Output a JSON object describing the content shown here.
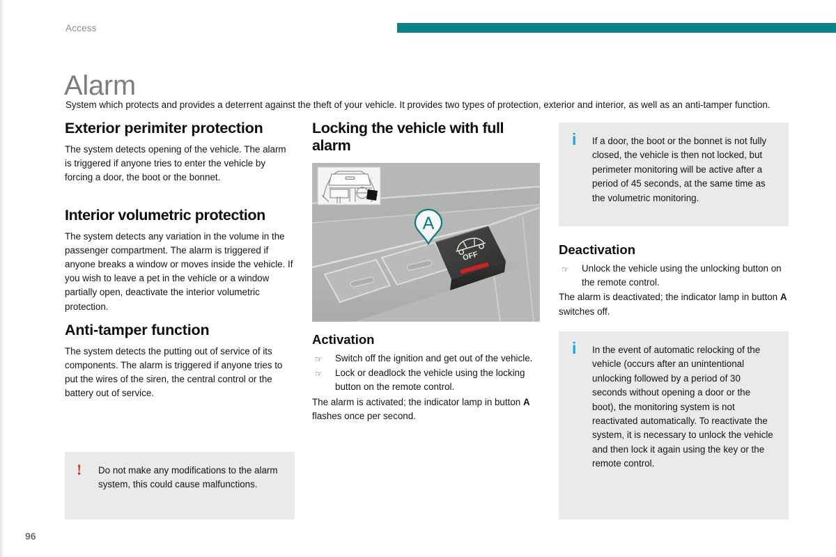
{
  "header": {
    "section_label": "Access",
    "rule_color": "#06828a"
  },
  "title": "Alarm",
  "intro": "System which protects and provides a deterrent against the theft of your vehicle. It provides two types of protection, exterior and interior, as well as an anti-tamper function.",
  "left_column": {
    "exterior": {
      "heading": "Exterior perimiter protection",
      "body": "The system detects opening of the vehicle. The alarm is triggered if anyone tries to enter the vehicle by forcing a door, the boot or the bonnet."
    },
    "interior": {
      "heading": "Interior volumetric protection",
      "body": "The system detects any variation in the volume in the passenger compartment. The alarm is triggered if anyone breaks a window or moves inside the vehicle. If you wish to leave a pet in the vehicle or a window partially open, deactivate the interior volumetric protection."
    },
    "antitamper": {
      "heading": "Anti-tamper function",
      "body": "The system detects the putting out of service of its components. The alarm is triggered if anyone tries to put the wires of the siren, the central control or the battery out of service."
    },
    "warning_callout": {
      "icon": "exclamation-icon",
      "icon_glyph": "!",
      "icon_color": "#e03030",
      "text": "Do not make any modifications to the alarm system, this could cause malfunctions."
    }
  },
  "middle_column": {
    "heading": "Locking the vehicle with full alarm",
    "figure": {
      "name": "dashboard-alarm-button-photo",
      "callout_letter": "A",
      "callout_color": "#0b7a7f",
      "button_label": "OFF",
      "inset_name": "vehicle-interior-location-diagram"
    },
    "activation": {
      "heading": "Activation",
      "steps": [
        "Switch off the ignition and get out of the vehicle.",
        "Lock or deadlock the vehicle using the locking button on the remote control."
      ],
      "result_prefix": "The alarm is activated; the indicator lamp in button ",
      "result_button": "A",
      "result_suffix": " flashes once per second."
    }
  },
  "right_column": {
    "info_callout_1": {
      "icon": "info-icon",
      "icon_glyph": "i",
      "icon_color": "#1ba0e0",
      "text": "If a door, the boot or the bonnet is not fully closed, the vehicle is then not locked, but perimeter monitoring will be active after a period of 45 seconds, at the same time as the volumetric monitoring."
    },
    "deactivation": {
      "heading": "Deactivation",
      "steps": [
        "Unlock the vehicle using the unlocking button on the remote control."
      ],
      "result_prefix": "The alarm is deactivated; the indicator lamp in button ",
      "result_button": "A",
      "result_suffix": " switches off."
    },
    "info_callout_2": {
      "icon": "info-icon",
      "icon_glyph": "i",
      "icon_color": "#1ba0e0",
      "text": "In the event of automatic relocking of the vehicle (occurs after an unintentional unlocking followed by a period of 30 seconds without opening a door or the boot), the monitoring system is not reactivated automatically. To reactivate the system, it is necessary to unlock the vehicle and then lock it again using the key or the remote control."
    }
  },
  "bullet_glyph": "☞",
  "page_number": "96"
}
